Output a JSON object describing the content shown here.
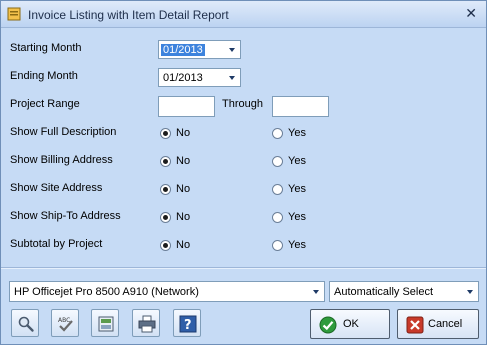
{
  "window": {
    "title": "Invoice Listing with Item Detail Report",
    "close_glyph": "✕"
  },
  "fields": {
    "starting_month": {
      "label": "Starting Month",
      "value": "01/2013"
    },
    "ending_month": {
      "label": "Ending Month",
      "value": "01/2013"
    },
    "project_range": {
      "label": "Project Range",
      "through_label": "Through",
      "from": "",
      "to": ""
    }
  },
  "options": [
    {
      "label": "Show Full Description",
      "selected": "no"
    },
    {
      "label": "Show Billing Address",
      "selected": "no"
    },
    {
      "label": "Show Site Address",
      "selected": "no"
    },
    {
      "label": "Show Ship-To Address",
      "selected": "no"
    },
    {
      "label": "Subtotal by Project",
      "selected": "no"
    }
  ],
  "radio_labels": {
    "no": "No",
    "yes": "Yes"
  },
  "printer": {
    "name": "HP Officejet Pro 8500 A910 (Network)",
    "tray": "Automatically Select"
  },
  "toolbar": [
    {
      "icon": "preview-magnifier-icon"
    },
    {
      "icon": "spellcheck-icon"
    },
    {
      "icon": "export-icon"
    },
    {
      "icon": "print-icon"
    },
    {
      "icon": "help-icon"
    }
  ],
  "buttons": {
    "ok": "OK",
    "cancel": "Cancel"
  },
  "colors": {
    "background": "#c6dbf5",
    "selection": "#3d83dd",
    "ok_green": "#2e9b3c",
    "cancel_red": "#c83a2a"
  }
}
